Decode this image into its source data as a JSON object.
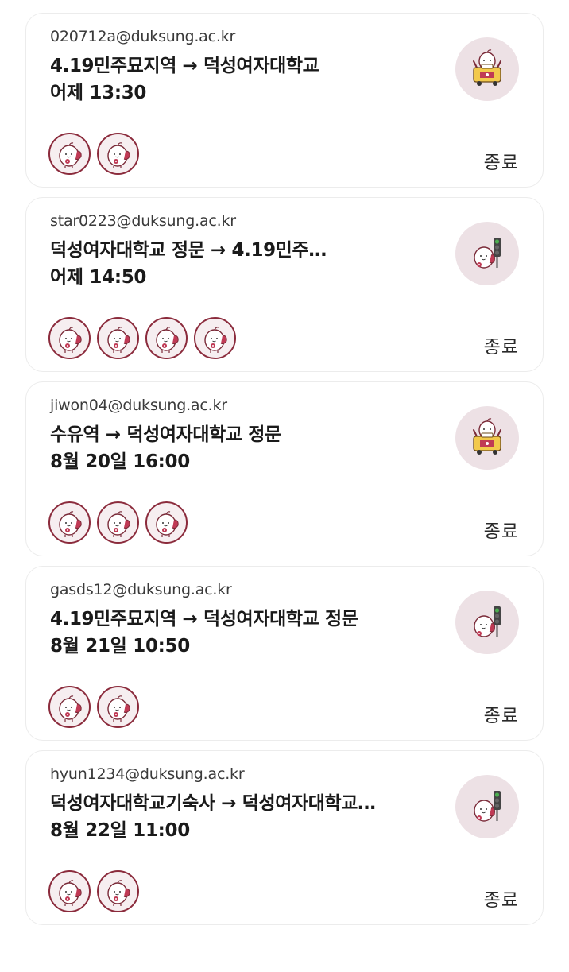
{
  "colors": {
    "accent": "#8b2b3c",
    "icon_bg": "#ede1e5",
    "card_border": "#ececec"
  },
  "rides": [
    {
      "email": "020712a@duksung.ac.kr",
      "route": "4.19민주묘지역 → 덕성여자대학교",
      "time": "어제 13:30",
      "members": 2,
      "mode_icon": "taxi-icon",
      "status": "종료"
    },
    {
      "email": "star0223@duksung.ac.kr",
      "route": "덕성여자대학교 정문 → 4.19민주…",
      "time": "어제 14:50",
      "members": 4,
      "mode_icon": "traffic-light-icon",
      "status": "종료"
    },
    {
      "email": "jiwon04@duksung.ac.kr",
      "route": "수유역 → 덕성여자대학교 정문",
      "time": "8월 20일 16:00",
      "members": 3,
      "mode_icon": "taxi-icon",
      "status": "종료"
    },
    {
      "email": "gasds12@duksung.ac.kr",
      "route": "4.19민주묘지역 → 덕성여자대학교 정문",
      "time": "8월 21일 10:50",
      "members": 2,
      "mode_icon": "traffic-light-icon",
      "status": "종료"
    },
    {
      "email": "hyun1234@duksung.ac.kr",
      "route": "덕성여자대학교기숙사 → 덕성여자대학교…",
      "time": "8월 22일 11:00",
      "members": 2,
      "mode_icon": "traffic-light-icon",
      "status": "종료"
    }
  ]
}
